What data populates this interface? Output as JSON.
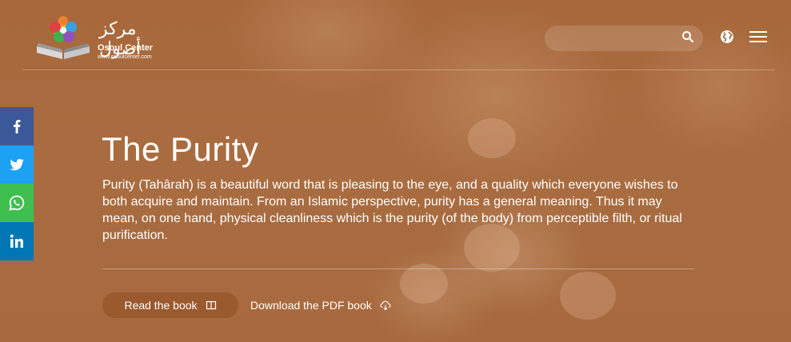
{
  "logo": {
    "arabic": "مركز أصول",
    "name": "Osoul Center",
    "url": "www.osoulcenter.com"
  },
  "header": {
    "search_placeholder": "",
    "icons": [
      "search-icon",
      "globe-icon",
      "menu-icon"
    ]
  },
  "share": {
    "icons": [
      "facebook-icon",
      "twitter-icon",
      "whatsapp-icon",
      "linkedin-icon"
    ],
    "colors": {
      "facebook": "#3b5998",
      "twitter": "#1da1f2",
      "whatsapp": "#3fbf4f",
      "linkedin": "#0077b5"
    }
  },
  "book": {
    "title": "The Purity",
    "description": "Purity (Tahârah) is a beautiful word that is pleasing to the eye, and a quality which everyone wishes to both acquire and maintain. From an Islamic perspective, purity has a general meaning. Thus it may mean, on one hand, physical cleanliness which is the purity (of the body) from perceptible filth, or ritual purification.",
    "read_label": "Read the book",
    "download_label": "Download the PDF book"
  },
  "colors": {
    "background": "#a56a3e",
    "read_button": "#9a5a2e",
    "text": "#ffffff"
  }
}
